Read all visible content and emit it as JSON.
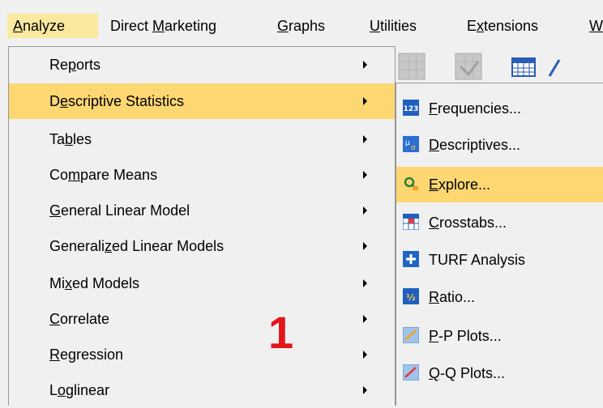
{
  "menubar": {
    "items": [
      {
        "pre": "",
        "u": "A",
        "post": "nalyze"
      },
      {
        "pre": "Direct ",
        "u": "M",
        "post": "arketing"
      },
      {
        "pre": "",
        "u": "G",
        "post": "raphs"
      },
      {
        "pre": "",
        "u": "U",
        "post": "tilities"
      },
      {
        "pre": "E",
        "u": "x",
        "post": "tensions"
      },
      {
        "pre": "",
        "u": "W",
        "post": ""
      }
    ]
  },
  "analyze_menu": {
    "items": [
      {
        "pre": "Re",
        "u": "p",
        "post": "orts"
      },
      {
        "pre": "D",
        "u": "e",
        "post": "scriptive Statistics"
      },
      {
        "pre": "Ta",
        "u": "b",
        "post": "les"
      },
      {
        "pre": "Co",
        "u": "m",
        "post": "pare Means"
      },
      {
        "pre": "",
        "u": "G",
        "post": "eneral Linear Model"
      },
      {
        "pre": "Generali",
        "u": "z",
        "post": "ed Linear Models"
      },
      {
        "pre": "Mi",
        "u": "x",
        "post": "ed Models"
      },
      {
        "pre": "",
        "u": "C",
        "post": "orrelate"
      },
      {
        "pre": "",
        "u": "R",
        "post": "egression"
      },
      {
        "pre": "L",
        "u": "o",
        "post": "glinear"
      }
    ]
  },
  "descriptive_submenu": {
    "items": [
      {
        "icon": "frequencies-icon",
        "pre": "",
        "u": "F",
        "post": "requencies..."
      },
      {
        "icon": "descriptives-icon",
        "pre": "",
        "u": "D",
        "post": "escriptives..."
      },
      {
        "icon": "explore-icon",
        "pre": "",
        "u": "E",
        "post": "xplore..."
      },
      {
        "icon": "crosstabs-icon",
        "pre": "",
        "u": "C",
        "post": "rosstabs..."
      },
      {
        "icon": "turf-icon",
        "pre": "",
        "u": "",
        "post": "TURF Analysis"
      },
      {
        "icon": "ratio-icon",
        "pre": "",
        "u": "R",
        "post": "atio..."
      },
      {
        "icon": "pp-plots-icon",
        "pre": "",
        "u": "P",
        "post": "-P Plots..."
      },
      {
        "icon": "qq-plots-icon",
        "pre": "",
        "u": "Q",
        "post": "-Q Plots..."
      }
    ]
  },
  "annotation": {
    "step": "1"
  },
  "colors": {
    "highlight": "#fcd772",
    "menubar_active": "#fbe9a0",
    "marker": "#e3141b"
  }
}
